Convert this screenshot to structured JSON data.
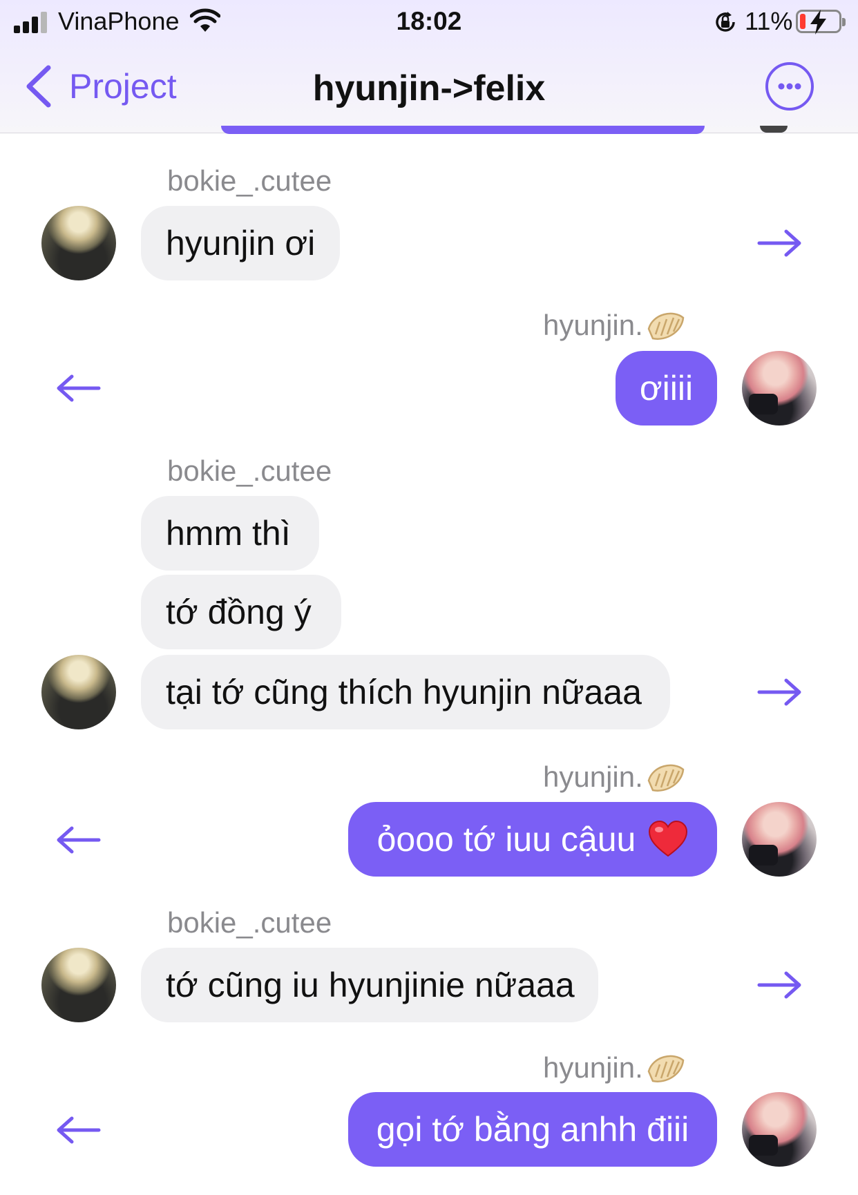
{
  "status_bar": {
    "carrier": "VinaPhone",
    "time": "18:02",
    "battery": "11%"
  },
  "nav": {
    "back_label": "Project",
    "title": "hyunjin->felix"
  },
  "colors": {
    "accent": "#7559f1",
    "outgoing_bubble": "#7b5ff5",
    "incoming_bubble": "#f0f0f2",
    "sender_name": "#8a8a8e"
  },
  "messages": [
    {
      "sender": "bokie_.cutee",
      "side": "left",
      "lines": [
        "hyunjin ơi"
      ]
    },
    {
      "sender": "hyunjin.",
      "side": "right",
      "lines": [
        "ơiiii"
      ]
    },
    {
      "sender": "bokie_.cutee",
      "side": "left",
      "lines": [
        "hmm thì",
        "tớ đồng ý",
        "tại tớ cũng thích hyunjin nữaaa"
      ]
    },
    {
      "sender": "hyunjin.",
      "side": "right",
      "lines": [
        "ỏooo tớ iuu cậuu"
      ],
      "emoji": "red-heart"
    },
    {
      "sender": "bokie_.cutee",
      "side": "left",
      "lines": [
        "tớ cũng iu hyunjinie nữaaa"
      ]
    },
    {
      "sender": "hyunjin.",
      "side": "right",
      "lines": [
        "gọi tớ bằng anhh điii"
      ]
    }
  ]
}
